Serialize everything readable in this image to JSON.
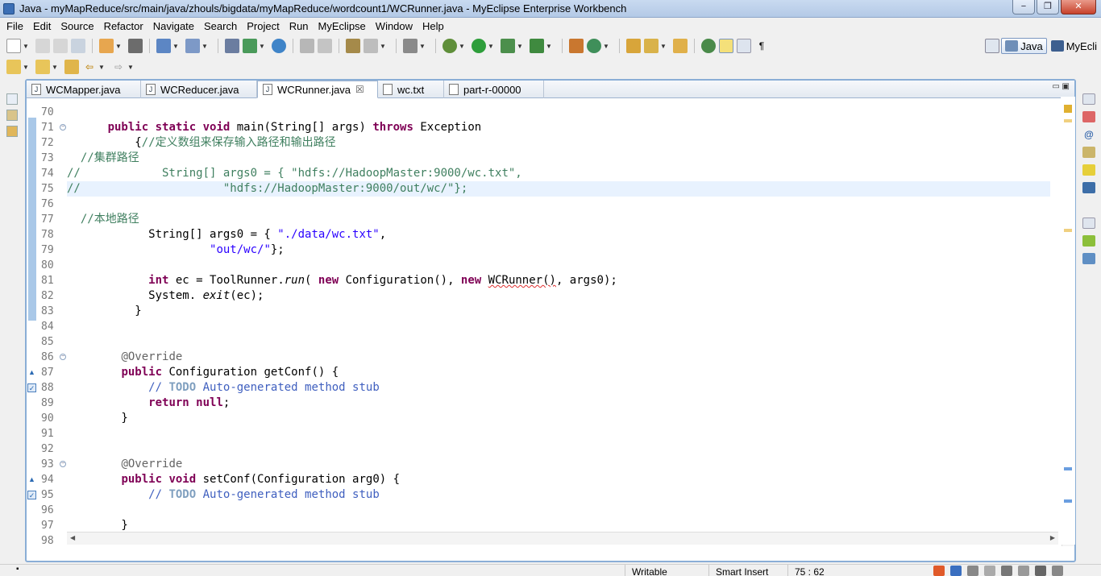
{
  "window": {
    "title": "Java - myMapReduce/src/main/java/zhouls/bigdata/myMapReduce/wordcount1/WCRunner.java - MyEclipse Enterprise Workbench",
    "minimize": "−",
    "restore": "❐",
    "close": "✕"
  },
  "menu": [
    "File",
    "Edit",
    "Source",
    "Refactor",
    "Navigate",
    "Search",
    "Project",
    "Run",
    "MyEclipse",
    "Window",
    "Help"
  ],
  "perspectives": {
    "java": "Java",
    "myeclipse": "MyEcli"
  },
  "tabs": [
    {
      "label": "WCMapper.java",
      "active": false
    },
    {
      "label": "WCReducer.java",
      "active": false
    },
    {
      "label": "WCRunner.java",
      "active": true,
      "close": "☒"
    },
    {
      "label": "wc.txt",
      "active": false
    },
    {
      "label": "part-r-00000",
      "active": false
    }
  ],
  "code": {
    "first_line": 70,
    "current_line": 75,
    "lines": [
      [],
      [
        [
          "      public static void main(String[] args) throws Exception",
          "mixed_main"
        ]
      ],
      [
        [
          "          {",
          "plain"
        ],
        [
          "//定义数组来保存输入路径和输出路径",
          "cm"
        ]
      ],
      [
        [
          "  //集群路径",
          "cm"
        ]
      ],
      [
        [
          "//            String[] args0 = { \"hdfs://HadoopMaster:9000/wc.txt\",",
          "cm"
        ]
      ],
      [
        [
          "//                     \"hdfs://HadoopMaster:9000/out/wc/\"};",
          "cm"
        ]
      ],
      [],
      [
        [
          "  //本地路径",
          "cm"
        ]
      ],
      [
        [
          "            String[] args0 = { ",
          "plain"
        ],
        [
          "\"./data/wc.txt\"",
          "str"
        ],
        [
          ",",
          "plain"
        ]
      ],
      [
        [
          "                     ",
          "plain"
        ],
        [
          "\"out/wc/\"",
          "str"
        ],
        [
          "};",
          "plain"
        ]
      ],
      [],
      [
        [
          "            ",
          "plain"
        ],
        [
          "int",
          "kw"
        ],
        [
          " ec = ToolRunner.",
          "plain"
        ],
        [
          "run",
          "it"
        ],
        [
          "( ",
          "plain"
        ],
        [
          "new",
          "kw"
        ],
        [
          " Configuration(), ",
          "plain"
        ],
        [
          "new",
          "kw"
        ],
        [
          " ",
          "plain"
        ],
        [
          "WCRunner()",
          "squig"
        ],
        [
          ", args0);",
          "plain"
        ]
      ],
      [
        [
          "            System. ",
          "plain"
        ],
        [
          "exit",
          "it"
        ],
        [
          "(ec);",
          "plain"
        ]
      ],
      [
        [
          "          }",
          "plain"
        ]
      ],
      [],
      [],
      [
        [
          "        ",
          "plain"
        ],
        [
          "@Override",
          "ann"
        ]
      ],
      [
        [
          "        ",
          "plain"
        ],
        [
          "public",
          "kw"
        ],
        [
          " Configuration getConf() {",
          "plain"
        ]
      ],
      [
        [
          "            ",
          "plain"
        ],
        [
          "// ",
          "cm-jd"
        ],
        [
          "TODO",
          "todo"
        ],
        [
          " Auto-generated method stub",
          "cm-jd"
        ]
      ],
      [
        [
          "            ",
          "plain"
        ],
        [
          "return",
          "kw"
        ],
        [
          " ",
          "plain"
        ],
        [
          "null",
          "kw"
        ],
        [
          ";",
          "plain"
        ]
      ],
      [
        [
          "        }",
          "plain"
        ]
      ],
      [],
      [],
      [
        [
          "        ",
          "plain"
        ],
        [
          "@Override",
          "ann"
        ]
      ],
      [
        [
          "        ",
          "plain"
        ],
        [
          "public",
          "kw"
        ],
        [
          " ",
          "plain"
        ],
        [
          "void",
          "kw"
        ],
        [
          " setConf(Configuration arg0) {",
          "plain"
        ]
      ],
      [
        [
          "            ",
          "plain"
        ],
        [
          "// ",
          "cm-jd"
        ],
        [
          "TODO",
          "todo"
        ],
        [
          " Auto-generated method stub",
          "cm-jd"
        ]
      ],
      [],
      [
        [
          "        }",
          "plain"
        ]
      ],
      []
    ],
    "fold_lines": [
      71,
      86,
      93
    ],
    "override_markers": [
      87,
      94
    ],
    "task_markers": [
      88,
      95
    ]
  },
  "status": {
    "writable": "Writable",
    "insert_mode": "Smart Insert",
    "position": "75 : 62"
  },
  "colors": {
    "keyword": "#7f0055",
    "string": "#2a00ff",
    "comment": "#3f7f5f",
    "javadoc_comment": "#3f5fbf",
    "annotation": "#646464",
    "current_line": "#e8f2fe"
  }
}
